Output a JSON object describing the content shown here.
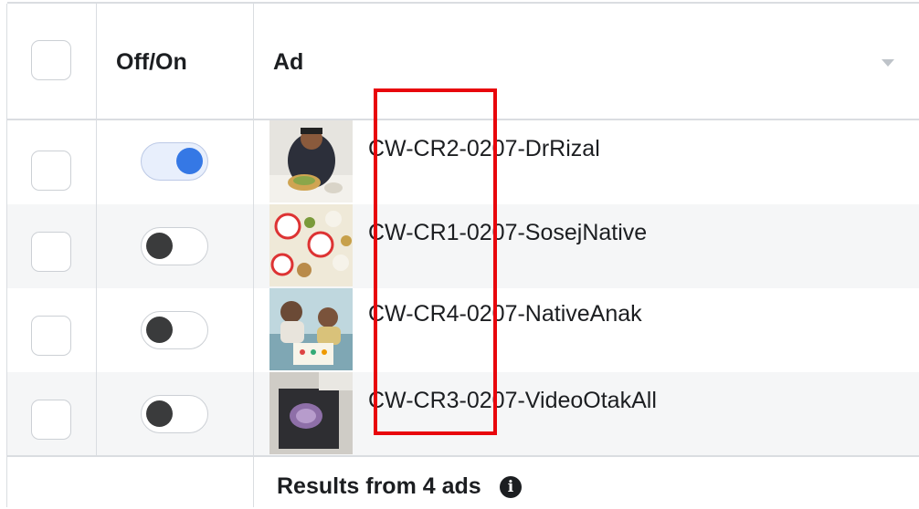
{
  "header": {
    "offon_label": "Off/On",
    "ad_label": "Ad"
  },
  "rows": [
    {
      "name": "CW-CR2-0207-DrRizal",
      "status": "on"
    },
    {
      "name": "CW-CR1-0207-SosejNative",
      "status": "off"
    },
    {
      "name": "CW-CR4-0207-NativeAnak",
      "status": "off"
    },
    {
      "name": "CW-CR3-0207-VideoOtakAll",
      "status": "off"
    }
  ],
  "footer": {
    "results_label": "Results from 4 ads",
    "info_icon_glyph": "i"
  },
  "colors": {
    "toggle_on": "#3578e5",
    "highlight_box": "#e8060c",
    "alt_row": "#f5f6f7"
  }
}
